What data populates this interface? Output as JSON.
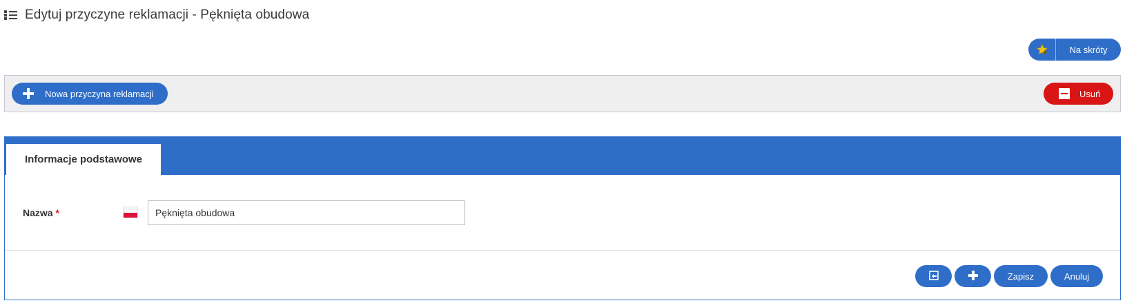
{
  "header": {
    "title": "Edytuj przyczyne reklamacji - Pęknięta obudowa"
  },
  "shortcuts": {
    "label": "Na skróty"
  },
  "toolbar": {
    "new_label": "Nowa przyczyna reklamacji",
    "delete_label": "Usuń"
  },
  "tabs": [
    {
      "label": "Informacje podstawowe",
      "active": true
    }
  ],
  "form": {
    "name_label": "Nazwa",
    "required_marker": "*",
    "name_value": "Pęknięta obudowa"
  },
  "actions": {
    "save_label": "Zapisz",
    "cancel_label": "Anuluj"
  },
  "colors": {
    "primary": "#2f6ec8",
    "danger": "#d81616",
    "star": "#f2c21b"
  }
}
